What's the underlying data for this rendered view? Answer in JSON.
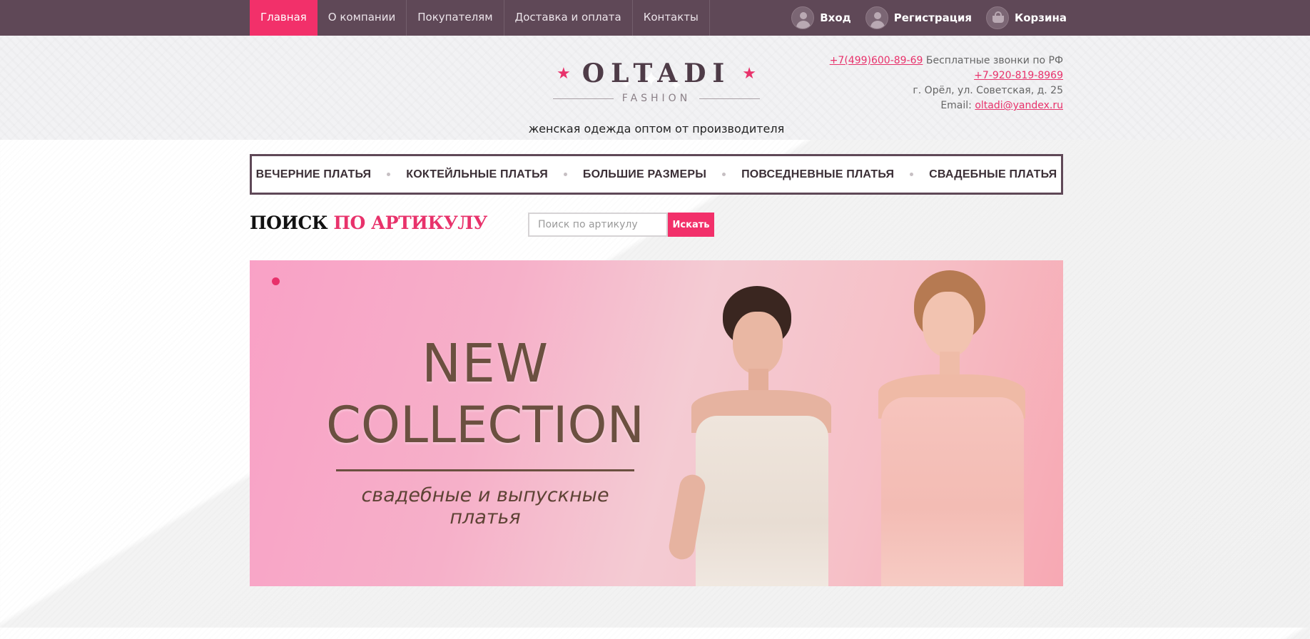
{
  "topnav": {
    "items": [
      {
        "label": "Главная",
        "active": true
      },
      {
        "label": "О компании",
        "active": false
      },
      {
        "label": "Покупателям",
        "active": false
      },
      {
        "label": "Доставка и оплата",
        "active": false
      },
      {
        "label": "Контакты",
        "active": false
      }
    ]
  },
  "userbar": {
    "login": "Вход",
    "register": "Регистрация",
    "cart": "Корзина"
  },
  "logo": {
    "name": "OLTADI",
    "sub": "FASHION",
    "tagline": "женская одежда оптом от производителя"
  },
  "contacts": {
    "phone1": "+7(499)600-89-69",
    "phone1_note": " Бесплатные звонки по РФ",
    "phone2": "+7-920-819-8969",
    "address": "г. Орёл, ул. Советская, д. 25",
    "email_label": "Email: ",
    "email": "oltadi@yandex.ru"
  },
  "categories": [
    "ВЕЧЕРНИЕ ПЛАТЬЯ",
    "КОКТЕЙЛЬНЫЕ ПЛАТЬЯ",
    "БОЛЬШИЕ РАЗМЕРЫ",
    "ПОВСЕДНЕВНЫЕ ПЛАТЬЯ",
    "СВАДЕБНЫЕ ПЛАТЬЯ"
  ],
  "search": {
    "title_part1": "ПОИСК ",
    "title_part2": "ПО АРТИКУЛУ",
    "placeholder": "Поиск по артикулу",
    "button": "Искать"
  },
  "banner": {
    "line1": "NEW",
    "line2": "COLLECTION",
    "sub1": "свадебные и выпускные",
    "sub2": "платья"
  },
  "colors": {
    "topbar": "#5f4857",
    "accent": "#f2306a",
    "pink_link": "#e8326b"
  }
}
